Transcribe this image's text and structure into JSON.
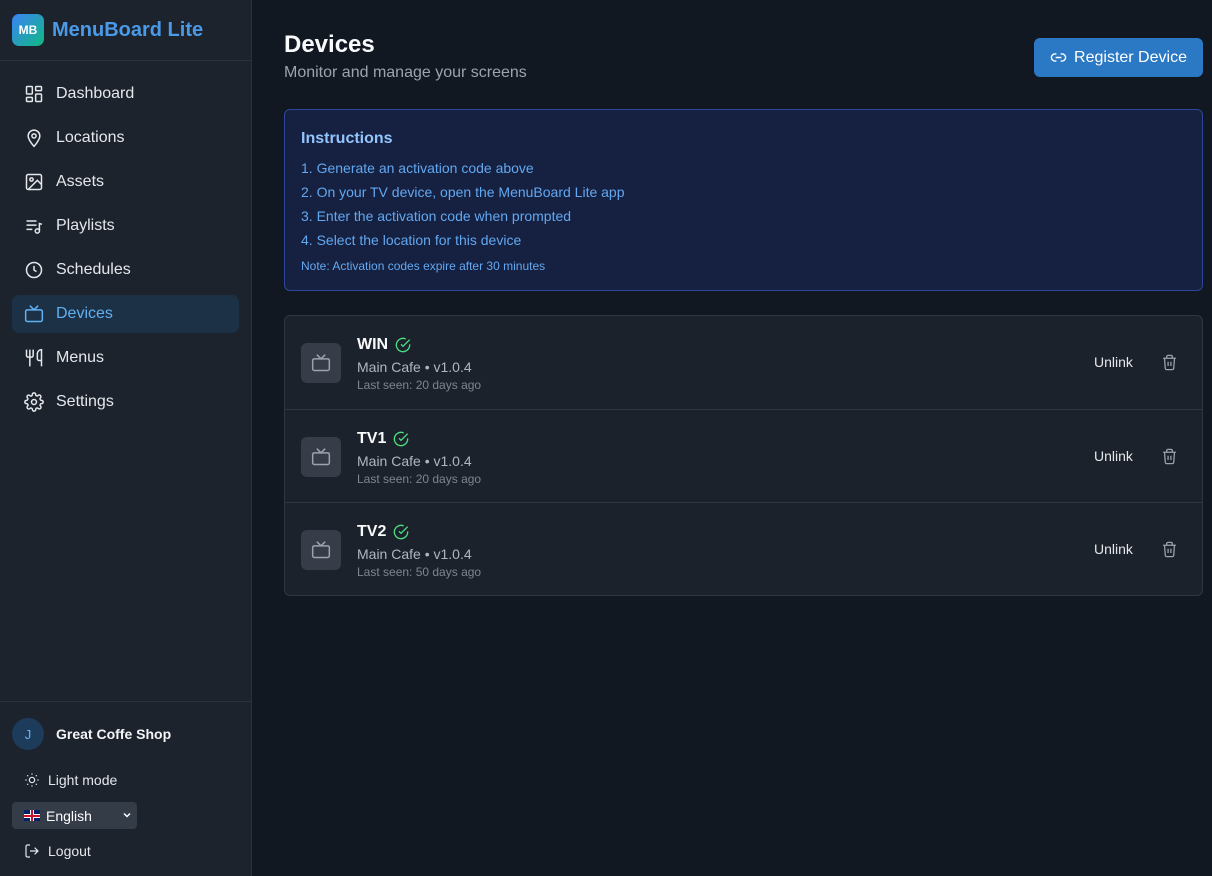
{
  "brand": {
    "logo_text": "MB",
    "name": "MenuBoard Lite"
  },
  "sidebar": {
    "items": [
      {
        "label": "Dashboard",
        "icon": "dashboard-icon"
      },
      {
        "label": "Locations",
        "icon": "map-pin-icon"
      },
      {
        "label": "Assets",
        "icon": "image-icon"
      },
      {
        "label": "Playlists",
        "icon": "playlist-icon"
      },
      {
        "label": "Schedules",
        "icon": "clock-icon"
      },
      {
        "label": "Devices",
        "icon": "tv-icon",
        "active": true
      },
      {
        "label": "Menus",
        "icon": "utensils-icon"
      },
      {
        "label": "Settings",
        "icon": "gear-icon"
      }
    ],
    "footer": {
      "avatar_initial": "J",
      "org_name": "Great Coffe Shop",
      "theme_toggle": "Light mode",
      "language": "English",
      "logout": "Logout"
    }
  },
  "page": {
    "title": "Devices",
    "subtitle": "Monitor and manage your screens",
    "register_button": "Register Device"
  },
  "instructions": {
    "title": "Instructions",
    "steps": [
      "1. Generate an activation code above",
      "2. On your TV device, open the MenuBoard Lite app",
      "3. Enter the activation code when prompted",
      "4. Select the location for this device"
    ],
    "note": "Note: Activation codes expire after 30 minutes"
  },
  "devices": [
    {
      "name": "WIN",
      "location": "Main Cafe",
      "version": "v1.0.4",
      "meta": "Main Cafe • v1.0.4",
      "last_seen": "Last seen: 20 days ago",
      "status": "online",
      "unlink_label": "Unlink"
    },
    {
      "name": "TV1",
      "location": "Main Cafe",
      "version": "v1.0.4",
      "meta": "Main Cafe • v1.0.4",
      "last_seen": "Last seen: 20 days ago",
      "status": "online",
      "unlink_label": "Unlink"
    },
    {
      "name": "TV2",
      "location": "Main Cafe",
      "version": "v1.0.4",
      "meta": "Main Cafe • v1.0.4",
      "last_seen": "Last seen: 50 days ago",
      "status": "online",
      "unlink_label": "Unlink"
    }
  ],
  "colors": {
    "background": "#121821",
    "sidebar": "#1c232d",
    "accent": "#2b78c4",
    "active_nav_bg": "#1c3146",
    "active_nav_text": "#5fb1f2",
    "status_ok": "#4ade80"
  }
}
